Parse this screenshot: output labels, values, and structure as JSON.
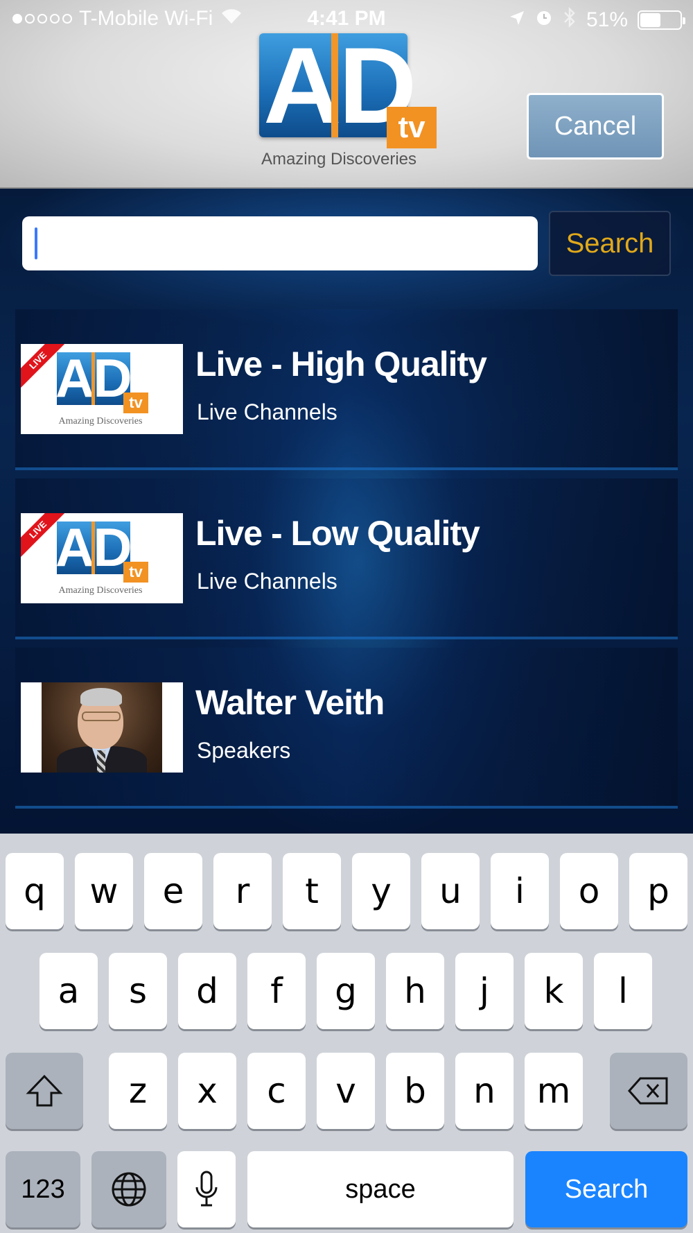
{
  "status_bar": {
    "carrier": "T-Mobile Wi-Fi",
    "time": "4:41 PM",
    "battery": "51%",
    "battery_level": 0.51
  },
  "logo": {
    "letters": "AD",
    "badge": "tv",
    "tagline": "Amazing Discoveries"
  },
  "header": {
    "cancel_label": "Cancel"
  },
  "search": {
    "value": "",
    "button_label": "Search"
  },
  "results": [
    {
      "title": "Live - High Quality",
      "subtitle": "Live Channels",
      "thumb": "live-logo",
      "ribbon": "LIVE"
    },
    {
      "title": "Live - Low Quality",
      "subtitle": "Live Channels",
      "thumb": "live-logo",
      "ribbon": "LIVE"
    },
    {
      "title": "Walter Veith",
      "subtitle": "Speakers",
      "thumb": "speaker-photo"
    }
  ],
  "keyboard": {
    "row1": [
      "q",
      "w",
      "e",
      "r",
      "t",
      "y",
      "u",
      "i",
      "o",
      "p"
    ],
    "row2": [
      "a",
      "s",
      "d",
      "f",
      "g",
      "h",
      "j",
      "k",
      "l"
    ],
    "row3": [
      "z",
      "x",
      "c",
      "v",
      "b",
      "n",
      "m"
    ],
    "numbers_label": "123",
    "space_label": "space",
    "return_label": "Search",
    "icons": {
      "shift": "shift-icon",
      "delete": "delete-icon",
      "globe": "globe-icon",
      "mic": "microphone-icon"
    }
  },
  "colors": {
    "accent_orange": "#f29223",
    "search_button_text": "#e1a91a",
    "keyboard_return": "#1a84ff",
    "live_ribbon": "#e1141b"
  }
}
